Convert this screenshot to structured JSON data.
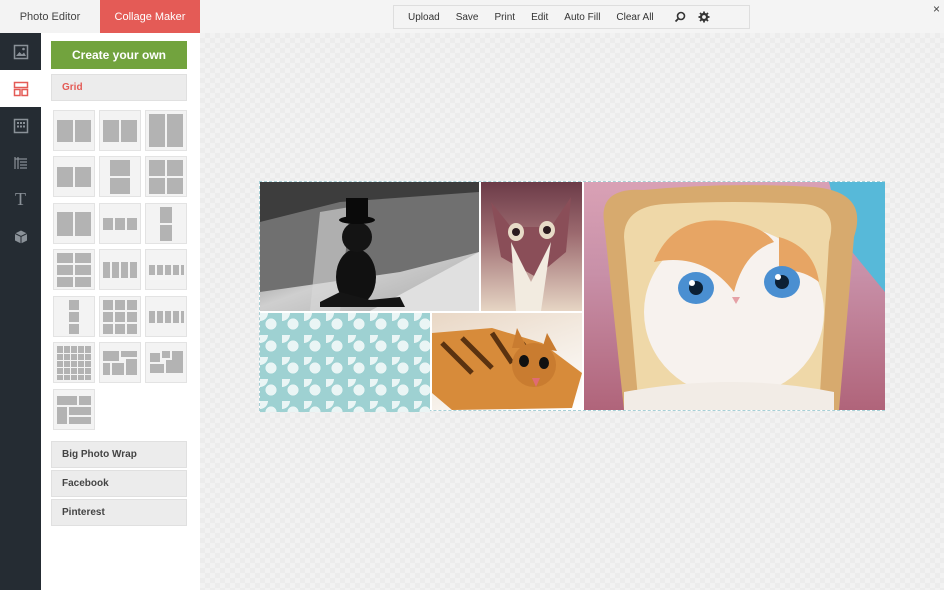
{
  "tabs": {
    "photo_editor": "Photo Editor",
    "collage_maker": "Collage Maker"
  },
  "toolbar": {
    "upload": "Upload",
    "save": "Save",
    "print": "Print",
    "edit": "Edit",
    "auto_fill": "Auto Fill",
    "clear_all": "Clear All"
  },
  "close_glyph": "×",
  "rail": [
    {
      "name": "photos",
      "icon": "image-icon"
    },
    {
      "name": "layouts",
      "icon": "layout-icon"
    },
    {
      "name": "backgrounds",
      "icon": "pattern-icon"
    },
    {
      "name": "text-styles",
      "icon": "texture-icon"
    },
    {
      "name": "text",
      "icon": "text-icon"
    },
    {
      "name": "stickers",
      "icon": "cube-icon"
    }
  ],
  "sidebar": {
    "create_label": "Create your own",
    "grid_label": "Grid",
    "big_photo_wrap": "Big Photo Wrap",
    "facebook": "Facebook",
    "pinterest": "Pinterest"
  },
  "colors": {
    "accent": "#e45b56",
    "create": "#72a33e",
    "rail": "#252c33"
  }
}
